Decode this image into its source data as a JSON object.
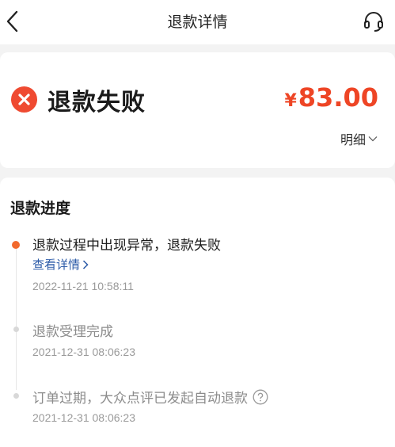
{
  "header": {
    "title": "退款详情",
    "back_icon": "back-arrow-icon",
    "service_icon": "headset-icon"
  },
  "status": {
    "text": "退款失败",
    "icon": "error-x-icon",
    "currency": "¥",
    "amount": "83.00",
    "detail_label": "明细",
    "accent_color": "#ee4525"
  },
  "progress": {
    "title": "退款进度",
    "steps": [
      {
        "title": "退款过程中出现异常，退款失败",
        "link": "查看详情",
        "time": "2022-11-21 10:58:11",
        "active": true
      },
      {
        "title": "退款受理完成",
        "time": "2021-12-31 08:06:23",
        "active": false
      },
      {
        "title": "订单过期，大众点评已发起自动退款",
        "time": "2021-12-31 08:06:23",
        "active": false,
        "help_icon": "question-circle-icon"
      }
    ],
    "active_color": "#f26a2e",
    "link_color": "#2c5ba8"
  }
}
